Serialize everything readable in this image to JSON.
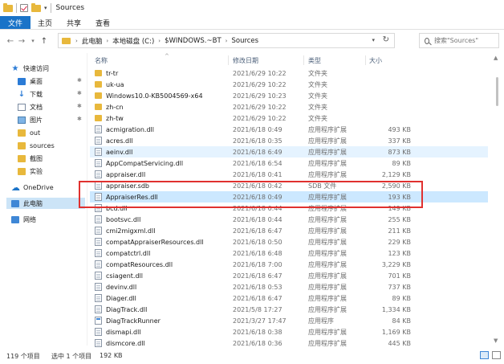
{
  "window": {
    "title": "Sources"
  },
  "ribbon": {
    "tabs": [
      "文件",
      "主页",
      "共享",
      "查看"
    ]
  },
  "address": {
    "crumbs": [
      "此电脑",
      "本地磁盘 (C:)",
      "$WINDOWS.~BT",
      "Sources"
    ]
  },
  "search": {
    "placeholder": "搜索\"Sources\""
  },
  "nav": {
    "items": [
      {
        "label": "快速访问",
        "icon": "star-icon"
      },
      {
        "label": "桌面",
        "icon": "desktop-icon"
      },
      {
        "label": "下载",
        "icon": "download-icon"
      },
      {
        "label": "文档",
        "icon": "document-icon"
      },
      {
        "label": "图片",
        "icon": "picture-icon"
      },
      {
        "label": "out",
        "icon": "folder-icon"
      },
      {
        "label": "sources",
        "icon": "folder-icon"
      },
      {
        "label": "截图",
        "icon": "folder-icon"
      },
      {
        "label": "实验",
        "icon": "folder-icon"
      },
      {
        "label": "OneDrive",
        "icon": "onedrive-icon"
      },
      {
        "label": "此电脑",
        "icon": "pc-icon"
      },
      {
        "label": "网络",
        "icon": "network-icon"
      }
    ]
  },
  "columns": {
    "name": "名称",
    "date": "修改日期",
    "type": "类型",
    "size": "大小"
  },
  "files": [
    {
      "name": "tr-tr",
      "date": "2021/6/29 10:22",
      "type": "文件夹",
      "size": "",
      "icon": "folder"
    },
    {
      "name": "uk-ua",
      "date": "2021/6/29 10:22",
      "type": "文件夹",
      "size": "",
      "icon": "folder"
    },
    {
      "name": "Windows10.0-KB5004569-x64",
      "date": "2021/6/29 10:23",
      "type": "文件夹",
      "size": "",
      "icon": "folder"
    },
    {
      "name": "zh-cn",
      "date": "2021/6/29 10:22",
      "type": "文件夹",
      "size": "",
      "icon": "folder"
    },
    {
      "name": "zh-tw",
      "date": "2021/6/29 10:22",
      "type": "文件夹",
      "size": "",
      "icon": "folder"
    },
    {
      "name": "acmigration.dll",
      "date": "2021/6/18 0:49",
      "type": "应用程序扩展",
      "size": "493 KB",
      "icon": "file"
    },
    {
      "name": "acres.dll",
      "date": "2021/6/18 0:35",
      "type": "应用程序扩展",
      "size": "337 KB",
      "icon": "file"
    },
    {
      "name": "aeinv.dll",
      "date": "2021/6/18 6:49",
      "type": "应用程序扩展",
      "size": "873 KB",
      "icon": "file"
    },
    {
      "name": "AppCompatServicing.dll",
      "date": "2021/6/18 6:54",
      "type": "应用程序扩展",
      "size": "89 KB",
      "icon": "file"
    },
    {
      "name": "appraiser.dll",
      "date": "2021/6/18 0:41",
      "type": "应用程序扩展",
      "size": "2,129 KB",
      "icon": "file"
    },
    {
      "name": "appraiser.sdb",
      "date": "2021/6/18 0:42",
      "type": "SDB 文件",
      "size": "2,590 KB",
      "icon": "file"
    },
    {
      "name": "AppraiserRes.dll",
      "date": "2021/6/18 0:49",
      "type": "应用程序扩展",
      "size": "193 KB",
      "icon": "file"
    },
    {
      "name": "bcd.dll",
      "date": "2021/6/18 0:44",
      "type": "应用程序扩展",
      "size": "149 KB",
      "icon": "file"
    },
    {
      "name": "bootsvc.dll",
      "date": "2021/6/18 0:44",
      "type": "应用程序扩展",
      "size": "255 KB",
      "icon": "file"
    },
    {
      "name": "cmi2migxml.dll",
      "date": "2021/6/18 6:47",
      "type": "应用程序扩展",
      "size": "211 KB",
      "icon": "file"
    },
    {
      "name": "compatAppraiserResources.dll",
      "date": "2021/6/18 0:50",
      "type": "应用程序扩展",
      "size": "229 KB",
      "icon": "file"
    },
    {
      "name": "compatctrl.dll",
      "date": "2021/6/18 6:48",
      "type": "应用程序扩展",
      "size": "123 KB",
      "icon": "file"
    },
    {
      "name": "compatResources.dll",
      "date": "2021/6/18 7:00",
      "type": "应用程序扩展",
      "size": "3,229 KB",
      "icon": "file"
    },
    {
      "name": "csiagent.dll",
      "date": "2021/6/18 6:47",
      "type": "应用程序扩展",
      "size": "701 KB",
      "icon": "file"
    },
    {
      "name": "devinv.dll",
      "date": "2021/6/18 0:53",
      "type": "应用程序扩展",
      "size": "737 KB",
      "icon": "file"
    },
    {
      "name": "Diager.dll",
      "date": "2021/6/18 6:47",
      "type": "应用程序扩展",
      "size": "89 KB",
      "icon": "file"
    },
    {
      "name": "DiagTrack.dll",
      "date": "2021/5/8 17:27",
      "type": "应用程序扩展",
      "size": "1,334 KB",
      "icon": "file"
    },
    {
      "name": "DiagTrackRunner",
      "date": "2021/3/27 17:47",
      "type": "应用程序",
      "size": "84 KB",
      "icon": "exe"
    },
    {
      "name": "dismapi.dll",
      "date": "2021/6/18 0:38",
      "type": "应用程序扩展",
      "size": "1,169 KB",
      "icon": "file"
    },
    {
      "name": "dismcore.dll",
      "date": "2021/6/18 0:36",
      "type": "应用程序扩展",
      "size": "445 KB",
      "icon": "file"
    }
  ],
  "hover_index": 7,
  "selected_index": 11,
  "status": {
    "count": "119 个项目",
    "selected": "选中 1 个项目",
    "size": "192 KB"
  }
}
